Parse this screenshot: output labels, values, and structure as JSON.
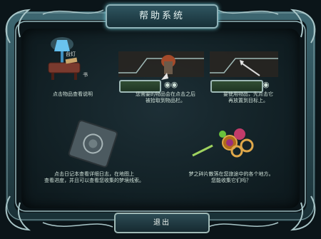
{
  "title": "帮助系统",
  "exit_label": "退出",
  "items": [
    {
      "labels": [
        "台灯",
        "书"
      ],
      "caption": "点击物品查看说明"
    },
    {
      "caption": "您需要的物品会在点击之后\n被拾取到物品栏。"
    },
    {
      "caption": "要使用物品，先点击它\n再放置到目标上。"
    },
    {
      "caption": "点击日记本查看详细日志，在地图上\n查看进度，并且可以查看您收集的梦境线索。"
    },
    {
      "caption": "梦之碎片散落在您旅途中的各个地方。\n您能收集它们吗？"
    }
  ],
  "colors": {
    "accent": "#6ec8d6",
    "panel": "#132227",
    "frame": "#8fb2b8"
  }
}
